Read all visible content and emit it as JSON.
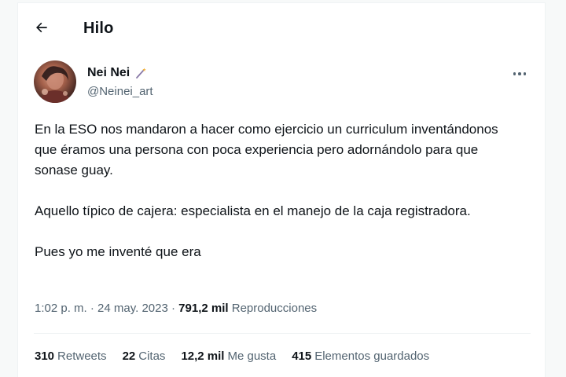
{
  "header": {
    "title": "Hilo",
    "back_icon": "arrow-left-icon"
  },
  "author": {
    "name": "Nei Nei",
    "name_icon": "magic-wand-icon",
    "handle": "@Neinei_art"
  },
  "more_icon": "more-horizontal-icon",
  "tweet": {
    "paragraphs": [
      "En la ESO nos mandaron a hacer como ejercicio un curriculum inventándonos que éramos una persona con poca experiencia pero adornándolo para que sonase guay.",
      "Aquello típico de cajera: especialista en el manejo de la caja registradora.",
      "Pues yo me inventé que era"
    ]
  },
  "meta": {
    "time": "1:02 p. m.",
    "separator": " · ",
    "date": "24 may. 2023",
    "views_count": "791,2 mil",
    "views_label": "Reproducciones"
  },
  "stats": {
    "retweets_count": "310",
    "retweets_label": "Retweets",
    "quotes_count": "22",
    "quotes_label": "Citas",
    "likes_count": "12,2 mil",
    "likes_label": "Me gusta",
    "bookmarks_count": "415",
    "bookmarks_label": "Elementos guardados"
  },
  "colors": {
    "text": "#0f1419",
    "secondary": "#536471",
    "border": "#eff3f4",
    "background": "#f7f9f9"
  }
}
